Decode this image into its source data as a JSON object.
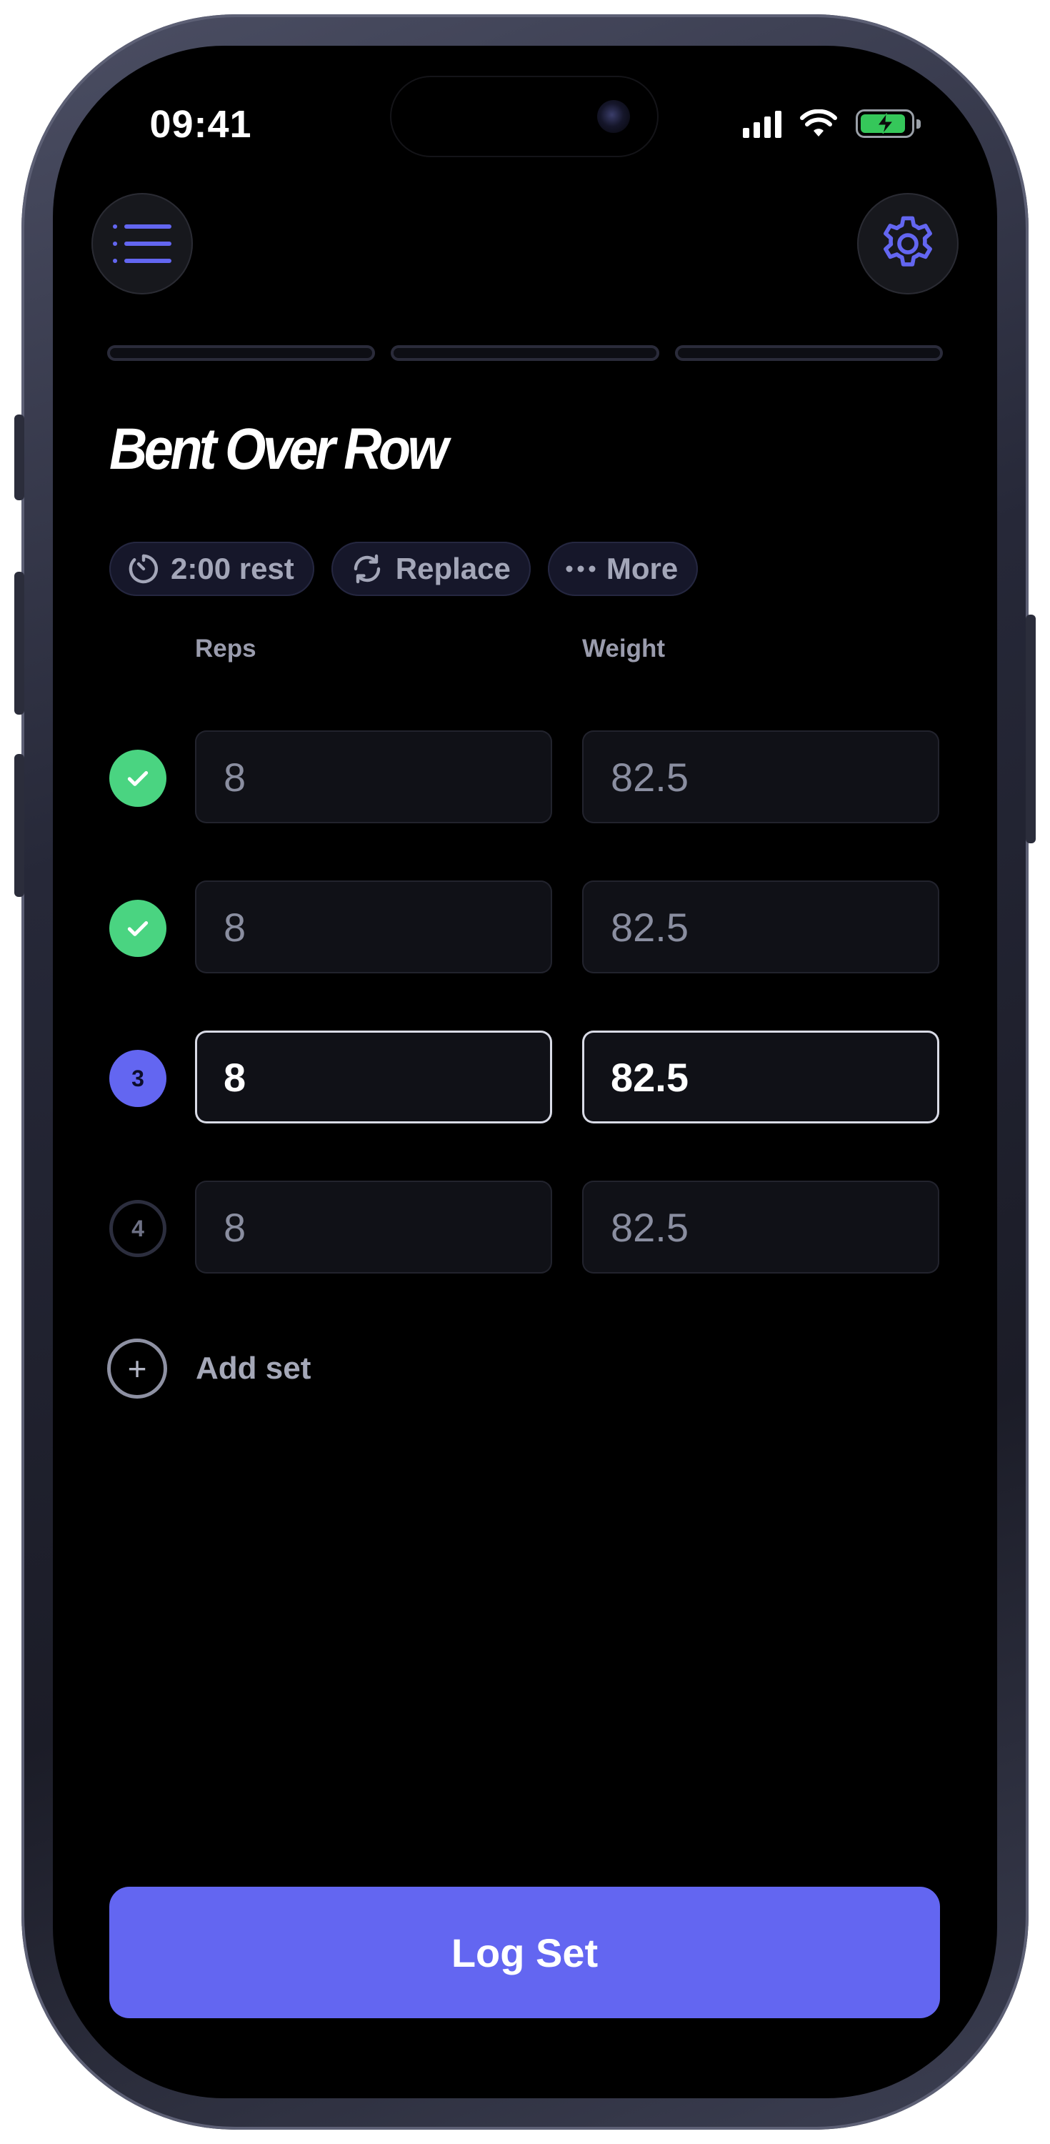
{
  "status_bar": {
    "time": "09:41",
    "icons": [
      "cellular-signal-icon",
      "wifi-icon",
      "battery-charging-icon"
    ]
  },
  "header": {
    "menu_icon": "list-icon",
    "settings_icon": "gear-icon"
  },
  "progress": {
    "segments": 3,
    "fills": [
      0,
      0,
      0
    ]
  },
  "exercise": {
    "title": "Bent Over Row",
    "chips": [
      {
        "icon": "timer-icon",
        "label": "2:00 rest"
      },
      {
        "icon": "refresh-icon",
        "label": "Replace"
      },
      {
        "icon": "more-dots-icon",
        "label": "More"
      }
    ]
  },
  "columns": {
    "reps": "Reps",
    "weight": "Weight"
  },
  "sets": [
    {
      "status": "done",
      "badge": "",
      "reps": "8",
      "weight": "82.5"
    },
    {
      "status": "done",
      "badge": "",
      "reps": "8",
      "weight": "82.5"
    },
    {
      "status": "active",
      "badge": "3",
      "reps": "8",
      "weight": "82.5"
    },
    {
      "status": "pending",
      "badge": "4",
      "reps": "8",
      "weight": "82.5"
    }
  ],
  "add_set": {
    "label": "Add set"
  },
  "log_button": {
    "label": "Log Set"
  },
  "colors": {
    "accent": "#6366f1",
    "success": "#4ad481",
    "background": "#000000"
  }
}
